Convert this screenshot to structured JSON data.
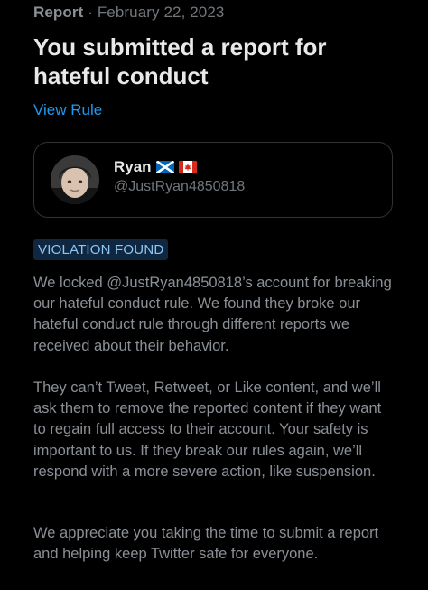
{
  "header": {
    "kind": "Report",
    "separator": "·",
    "date": "February 22, 2023",
    "title": "You submitted a report for hateful conduct",
    "view_rule_label": "View Rule"
  },
  "account": {
    "name": "Ryan",
    "handle": "@JustRyan4850818",
    "flags": [
      "scotland-flag",
      "canada-flag"
    ]
  },
  "status_badge": "VIOLATION FOUND",
  "body": {
    "paragraph_1": "We locked @JustRyan4850818’s account for breaking our hateful conduct rule. We found they broke our hateful conduct rule through different reports we received about their behavior.",
    "paragraph_2": "They can’t Tweet, Retweet, or Like content, and we’ll ask them to remove the reported content if they want to regain full access to their account. Your safety is important to us. If they break our rules again, we’ll respond with a more severe action, like suspension.",
    "paragraph_3": "We appreciate you taking the time to submit a report and helping keep Twitter safe for everyone."
  },
  "colors": {
    "background": "#000000",
    "primary_text": "#e7e9ea",
    "secondary_text": "#71767b",
    "link": "#1d9bf0",
    "badge_background": "#0f2741",
    "badge_text": "#8ec7f5",
    "card_border": "#2f3336"
  }
}
